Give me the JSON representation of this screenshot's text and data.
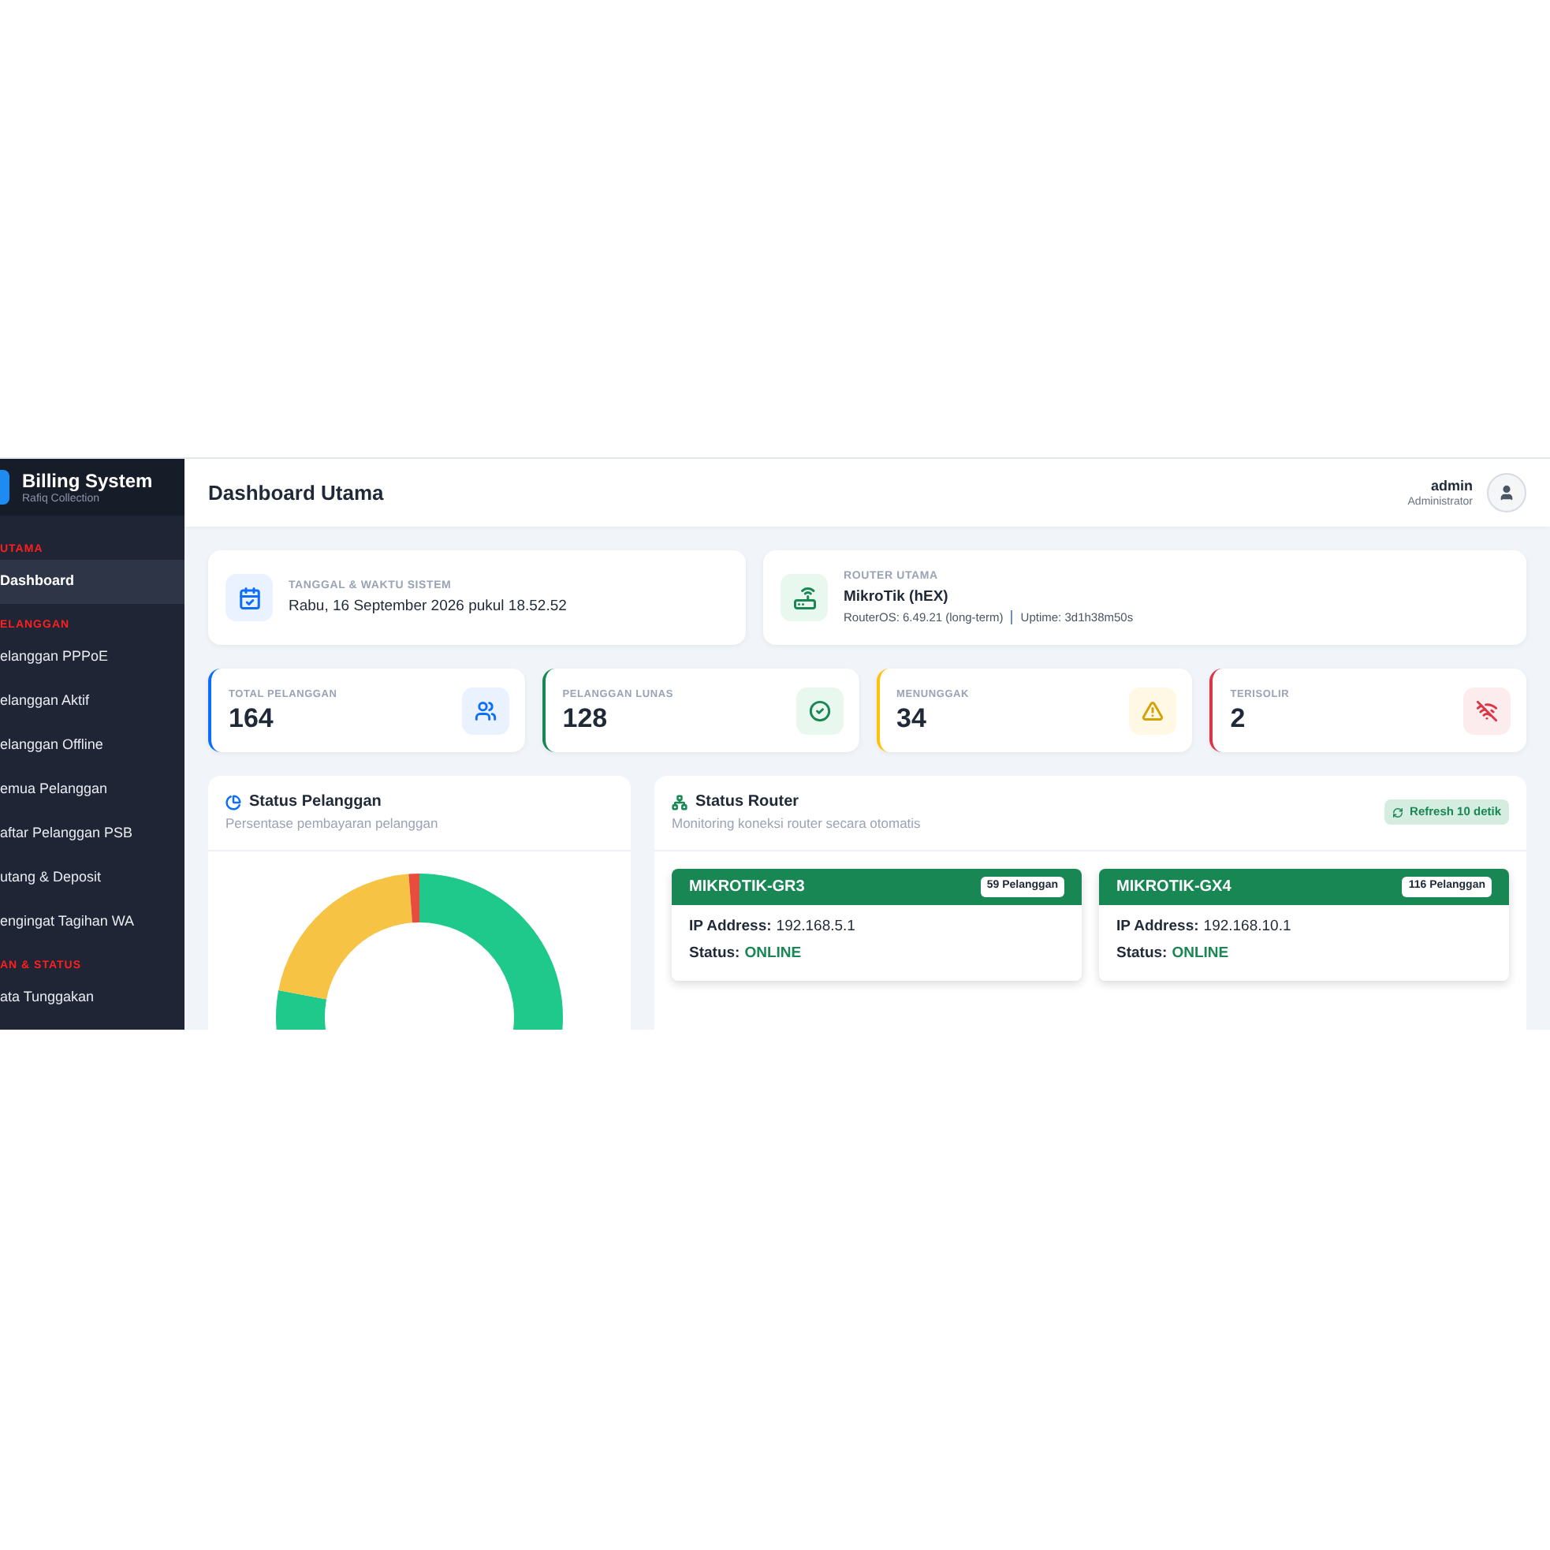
{
  "sidebar": {
    "brand": {
      "title": "Billing System",
      "subtitle": "Rafiq Collection"
    },
    "sections": [
      {
        "label": "UTAMA",
        "items": [
          {
            "label": "Dashboard",
            "selected": true
          }
        ]
      },
      {
        "label": "ELANGGAN",
        "items": [
          {
            "label": "elanggan PPPoE",
            "selected": false
          },
          {
            "label": "elanggan Aktif",
            "selected": false
          },
          {
            "label": "elanggan Offline",
            "selected": false
          },
          {
            "label": "emua Pelanggan",
            "selected": false
          },
          {
            "label": "aftar Pelanggan PSB",
            "selected": false
          },
          {
            "label": "utang & Deposit",
            "selected": false
          },
          {
            "label": "engingat Tagihan WA",
            "selected": false
          }
        ]
      },
      {
        "label": "AN & STATUS",
        "items": [
          {
            "label": "ata Tunggakan",
            "selected": false
          }
        ]
      }
    ]
  },
  "header": {
    "title": "Dashboard Utama",
    "user": {
      "name": "admin",
      "role": "Administrator"
    }
  },
  "info_cards": [
    {
      "kind": "datetime",
      "label": "TANGGAL & WAKTU SISTEM",
      "value": "Rabu, 16 September 2026 pukul 18.52.52"
    },
    {
      "kind": "router",
      "label": "ROUTER UTAMA",
      "value": "MikroTik (hEX)",
      "details": [
        "RouterOS: 6.49.21 (long-term)",
        "Uptime: 3d1h38m50s"
      ]
    }
  ],
  "stats": [
    {
      "kind": "total",
      "label": "TOTAL PELANGGAN",
      "value": "164",
      "color": "#0d6efd"
    },
    {
      "kind": "paid",
      "label": "PELANGGAN LUNAS",
      "value": "128",
      "color": "#198754"
    },
    {
      "kind": "pending",
      "label": "MENUNGGAK",
      "value": "34",
      "color": "#ffc107"
    },
    {
      "kind": "isolated",
      "label": "TERISOLIR",
      "value": "2",
      "color": "#dc3545"
    }
  ],
  "customer_status": {
    "title": "Status Pelanggan",
    "subtitle": "Persentase pembayaran pelanggan"
  },
  "router_status": {
    "title": "Status Router",
    "subtitle": "Monitoring koneksi router secara otomatis",
    "refresh": "Refresh 10 detik",
    "routers": [
      {
        "name": "MIKROTIK-GR3",
        "count": "59 Pelanggan",
        "ip_label": "IP Address:",
        "ip": "192.168.5.1",
        "status_label": "Status:",
        "status": "ONLINE",
        "online": true
      },
      {
        "name": "MIKROTIK-GX4",
        "count": "116 Pelanggan",
        "ip_label": "IP Address:",
        "ip": "192.168.10.1",
        "status_label": "Status:",
        "status": "ONLINE",
        "online": true
      }
    ]
  }
}
